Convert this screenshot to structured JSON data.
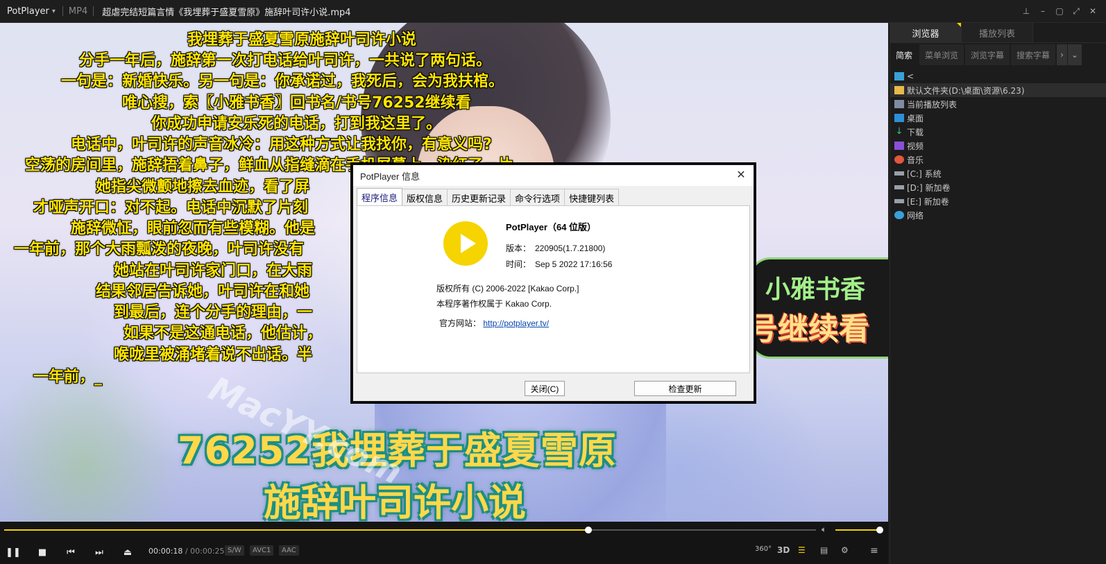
{
  "titlebar": {
    "app_name": "PotPlayer",
    "format": "MP4",
    "file_name": "超虐完结短篇言情《我埋葬于盛夏雪原》施辞叶司许小说.mp4"
  },
  "subtitles": [
    "我埋葬于盛夏雪原施辞叶司许小说",
    "分手一年后，施辞第一次打电话给叶司许，一共说了两句话。",
    "一句是：新婚快乐。另一句是：你承诺过，我死后，会为我扶棺。",
    "唯心搜，索〖小雅书香〗回书名/书号76252继续看",
    "你成功申请安乐死的电话，打到我这里了。",
    "电话中，叶司许的声音冰冷：用这种方式让我找你，有意义吗?",
    "空荡的房间里，施辞捂着鼻子，鲜血从指缝滴在手机屏幕上，染红了一片。",
    "她指尖微颤地擦去血迹，看了屏",
    "才哑声开口：对不起。电话中沉默了片刻",
    "施辞微怔，眼前忽而有些模糊。他是",
    "一年前，那个大雨瓢泼的夜晚，叶司许没有",
    "她站在叶司许家门口，在大雨",
    "结果邻居告诉她，叶司许在和她",
    "到最后，连个分手的理由，一",
    "如果不是这通电话，他估计，",
    "喉咙里被涌堵着说不出话。半",
    "一年前，_"
  ],
  "promo": {
    "line1": "小雅书香",
    "line2": "号继续看"
  },
  "banner": {
    "line1": "76252我埋葬于盛夏雪原",
    "line2": "施辞叶司许小说"
  },
  "watermark": "MacYY.com",
  "dialog": {
    "title": "PotPlayer 信息",
    "tabs": [
      "程序信息",
      "版权信息",
      "历史更新记录",
      "命令行选项",
      "快捷键列表"
    ],
    "product": "PotPlayer（64 位版）",
    "version_label": "版本：",
    "version": "220905(1.7.21800)",
    "time_label": "时间：",
    "time": "Sep  5 2022 17:16:56",
    "copyright": "版权所有 (C) 2006-2022 [Kakao Corp.]",
    "owner": "本程序著作权属于 Kakao Corp.",
    "site_label": "官方网站：",
    "site_url": "http://potplayer.tv/",
    "close_button": "关闭(C)",
    "update_button": "检查更新"
  },
  "controls": {
    "current_time": "00:00:18",
    "separator": "/",
    "total_time": "00:00:25",
    "progress": 0.72,
    "volume": 1.0,
    "tags": [
      "S/W",
      "AVC1",
      "AAC"
    ],
    "icons": [
      "pause-icon",
      "stop-icon",
      "prev-icon",
      "next-icon",
      "eject-icon",
      "360-icon",
      "3d-icon",
      "playlist-icon",
      "subtitle-icon",
      "settings-icon",
      "menu-icon"
    ],
    "label_360": "360°",
    "label_3d": "3D"
  },
  "sidebar": {
    "tabs": [
      "浏览器",
      "播放列表"
    ],
    "subtabs": [
      "简索",
      "菜单浏览",
      "浏览字幕",
      "搜索字幕"
    ],
    "items": [
      {
        "label": "<",
        "icon": "back-icon"
      },
      {
        "label": "默认文件夹(D:\\桌面\\资源\\6.23)",
        "icon": "folder-icon"
      },
      {
        "label": "当前播放列表",
        "icon": "playlist-icon"
      },
      {
        "label": "桌面",
        "icon": "desktop-icon"
      },
      {
        "label": "下载",
        "icon": "download-icon"
      },
      {
        "label": "视频",
        "icon": "video-icon"
      },
      {
        "label": "音乐",
        "icon": "music-icon"
      },
      {
        "label": "[C:] 系统",
        "icon": "drive-icon"
      },
      {
        "label": "[D:] 新加卷",
        "icon": "drive-icon"
      },
      {
        "label": "[E:] 新加卷",
        "icon": "drive-icon"
      },
      {
        "label": "网络",
        "icon": "network-icon"
      }
    ]
  },
  "colors": {
    "accent": "#f2d100",
    "subtitle": "#ffe600",
    "panel_bg": "#1c1c1c"
  }
}
